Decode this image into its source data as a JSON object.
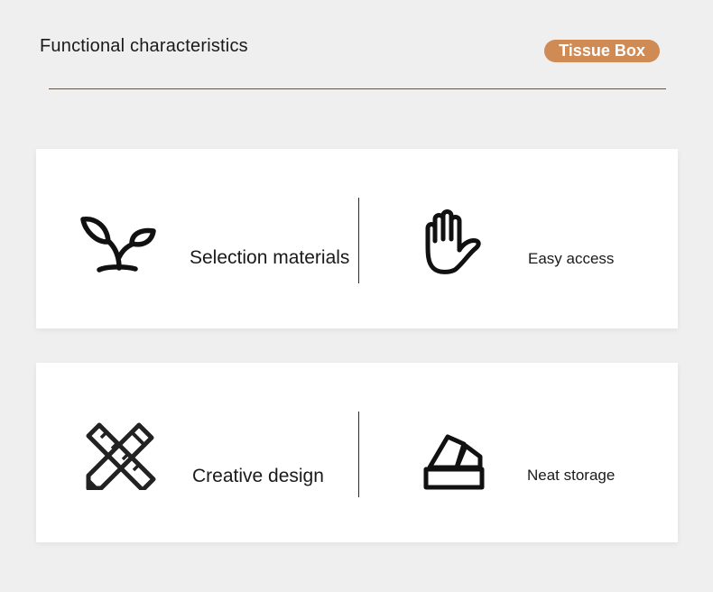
{
  "header": {
    "title": "Functional characteristics",
    "tag": "Tissue Box"
  },
  "features": [
    {
      "label": "Selection materials",
      "icon": "sprout-icon"
    },
    {
      "label": "Easy access",
      "icon": "hand-icon"
    },
    {
      "label": "Creative design",
      "icon": "pencil-ruler-icon"
    },
    {
      "label": "Neat storage",
      "icon": "tissue-box-icon"
    }
  ],
  "colors": {
    "background": "#efefef",
    "card": "#ffffff",
    "accent": "#d08a53",
    "text": "#1a1a1a"
  }
}
